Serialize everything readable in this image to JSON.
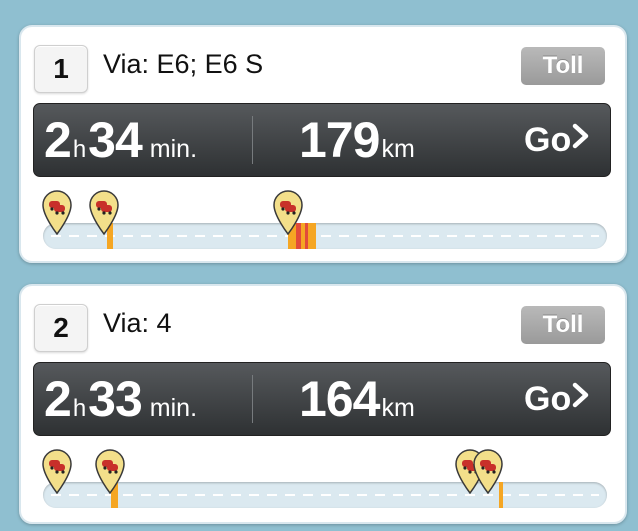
{
  "routes": [
    {
      "number": "1",
      "via": "Via: E6; E6 S",
      "toll": "Toll",
      "time_hours": "2",
      "time_hours_unit": "h",
      "time_minutes": "34",
      "time_minutes_unit": "min.",
      "distance": "179",
      "distance_unit": "km",
      "go_label": "Go",
      "traffic_icon": "traffic-jam-marker-icon",
      "colors": {
        "slow": "#f5a623",
        "jam": "#e24b3a"
      }
    },
    {
      "number": "2",
      "via": "Via: 4",
      "toll": "Toll",
      "time_hours": "2",
      "time_hours_unit": "h",
      "time_minutes": "33",
      "time_minutes_unit": "min.",
      "distance": "164",
      "distance_unit": "km",
      "go_label": "Go",
      "traffic_icon": "traffic-jam-marker-icon",
      "colors": {
        "slow": "#f5a623",
        "jam": "#e24b3a"
      }
    }
  ]
}
